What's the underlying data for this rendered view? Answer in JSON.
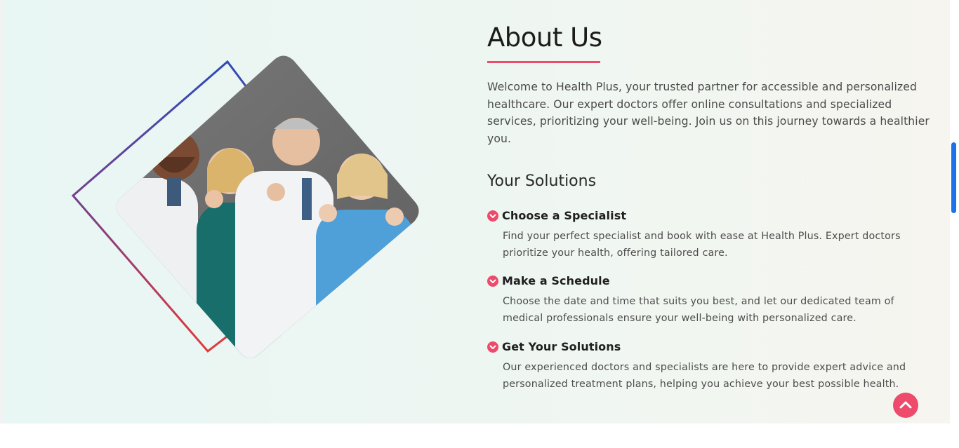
{
  "about": {
    "title": "About Us",
    "intro": "Welcome to Health Plus, your trusted partner for accessible and personalized healthcare. Our expert doctors offer online consultations and specialized services, prioritizing your well-being. Join us on this journey towards a healthier you.",
    "solutions_heading": "Your Solutions"
  },
  "solutions": [
    {
      "title": "Choose a Specialist",
      "description": "Find your perfect specialist and book with ease at Health Plus. Expert doctors prioritize your health, offering tailored care."
    },
    {
      "title": "Make a Schedule",
      "description": "Choose the date and time that suits you best, and let our dedicated team of medical professionals ensure your well-being with personalized care."
    },
    {
      "title": "Get Your Solutions",
      "description": "Our experienced doctors and specialists are here to provide expert advice and personalized treatment plans, helping you achieve your best possible health."
    }
  ],
  "icons": {
    "solution_icon": "chevron-down-circle-icon",
    "to_top_icon": "chevron-up-icon"
  },
  "colors": {
    "accent": "#ee4a6b",
    "frame_top": "#2d4bb8",
    "frame_bottom": "#e23a3a",
    "scrollbar": "#1a73e8",
    "photo_bg": "#6b6b6b"
  }
}
